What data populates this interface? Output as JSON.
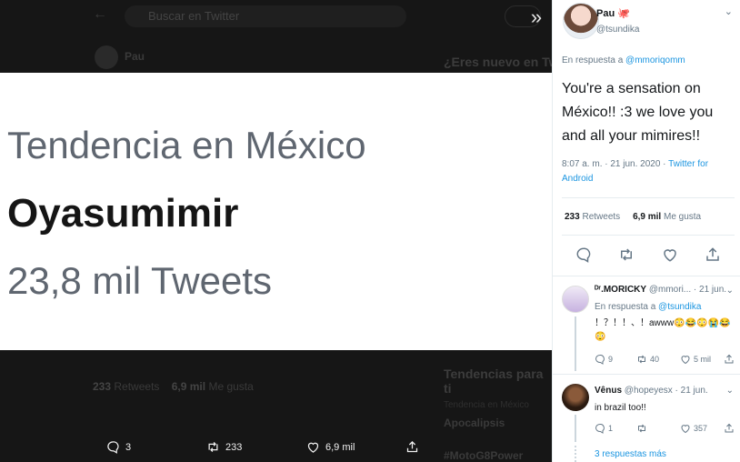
{
  "background": {
    "search_placeholder": "Buscar en Twitter",
    "author_name": "Pau",
    "right_title": "¿Eres nuevo en Twitter?",
    "stats_retweets_count": "233",
    "stats_retweets_label": "Retweets",
    "stats_likes_count": "6,9 mil",
    "stats_likes_label": "Me gusta",
    "trends_heading": "Tendencias para ti",
    "trend_sub": "Tendencia en México",
    "trend_1": "Apocalipsis",
    "trend_2": "#MotoG8Power"
  },
  "media": {
    "line1": "Tendencia en México",
    "line2": "Oyasumimir",
    "line3": "23,8 mil Tweets"
  },
  "media_actions": {
    "replies": "3",
    "retweets": "233",
    "likes": "6,9 mil"
  },
  "tweet": {
    "name": "Pau 🐙",
    "handle": "@tsundika",
    "reply_prefix": "En respuesta a",
    "reply_to": "@mmoriqomm",
    "text": "You're a sensation on México!! :3 we love you and all your mimires!!",
    "time": "8:07 a. m. · 21 jun. 2020 ·",
    "source": "Twitter for Android",
    "retweets_count": "233",
    "retweets_label": "Retweets",
    "likes_count": "6,9 mil",
    "likes_label": "Me gusta"
  },
  "replies": [
    {
      "name": "ᴰʳ.MORICKY",
      "handle": "@mmori...",
      "date": "· 21 jun.",
      "reply_prefix": "En respuesta a",
      "reply_to": "@tsundika",
      "text": "！？！！、！awww😳😂😳😭😂😳",
      "replies": "9",
      "retweets": "40",
      "likes": "5 mil"
    },
    {
      "name": "Vênus",
      "handle": "@hopeyesx",
      "date": "· 21 jun.",
      "text": "in brazil too!!",
      "replies": "1",
      "retweets": "",
      "likes": "357"
    }
  ],
  "more_replies": "3 respuestas más",
  "colors": {
    "link": "#1b95e0",
    "muted": "#657786",
    "text": "#14171a"
  }
}
